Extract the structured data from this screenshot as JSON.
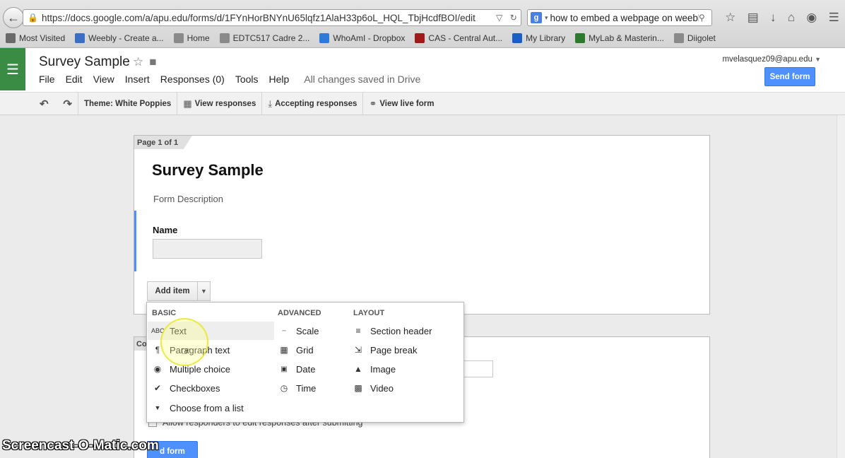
{
  "browser": {
    "url": "https://docs.google.com/a/apu.edu/forms/d/1FYnHorBNYnU65lqfz1AlaH33p6oL_HQL_TbjHcdfBOI/edit",
    "search_text": "how to embed a webpage on weebl",
    "bookmarks": [
      {
        "label": "Most Visited",
        "color": "#6a6a6a"
      },
      {
        "label": "Weebly - Create a...",
        "color": "#3a6fc4"
      },
      {
        "label": "Home",
        "color": "#8a8a8a"
      },
      {
        "label": "EDTC517 Cadre 2...",
        "color": "#8a8a8a"
      },
      {
        "label": "WhoAmI - Dropbox",
        "color": "#2e7ad6"
      },
      {
        "label": "CAS - Central Aut...",
        "color": "#a01a1a"
      },
      {
        "label": "My Library",
        "color": "#1a5fc4"
      },
      {
        "label": "MyLab & Masterin...",
        "color": "#2d7a2d"
      },
      {
        "label": "Diigolet",
        "color": "#8a8a8a"
      }
    ]
  },
  "docs": {
    "title": "Survey Sample",
    "menu": [
      "File",
      "Edit",
      "View",
      "Insert",
      "Responses (0)",
      "Tools",
      "Help"
    ],
    "saved_status": "All changes saved in Drive",
    "account": "mvelasquez09@apu.edu",
    "send_form": "Send form"
  },
  "toolbar": {
    "theme": "Theme: White Poppies",
    "view_responses": "View responses",
    "accepting": "Accepting responses",
    "view_live": "View live form"
  },
  "form": {
    "page_label": "Page 1 of 1",
    "title": "Survey Sample",
    "description": "Form Description",
    "question_label": "Name",
    "add_item": "Add item",
    "confirmation_tab": "Co",
    "allow_edit": "Allow responders to edit responses after submitting",
    "send_form_bottom": "d form"
  },
  "dropdown": {
    "basic_head": "BASIC",
    "advanced_head": "ADVANCED",
    "layout_head": "LAYOUT",
    "basic": [
      "Text",
      "Paragraph text",
      "Multiple choice",
      "Checkboxes",
      "Choose from a list"
    ],
    "advanced": [
      "Scale",
      "Grid",
      "Date",
      "Time"
    ],
    "layout": [
      "Section header",
      "Page break",
      "Image",
      "Video"
    ]
  },
  "watermark": "Screencast-O-Matic.com",
  "colors": {
    "accent_blue": "#4d90fe",
    "forms_green": "#3a8c44"
  }
}
